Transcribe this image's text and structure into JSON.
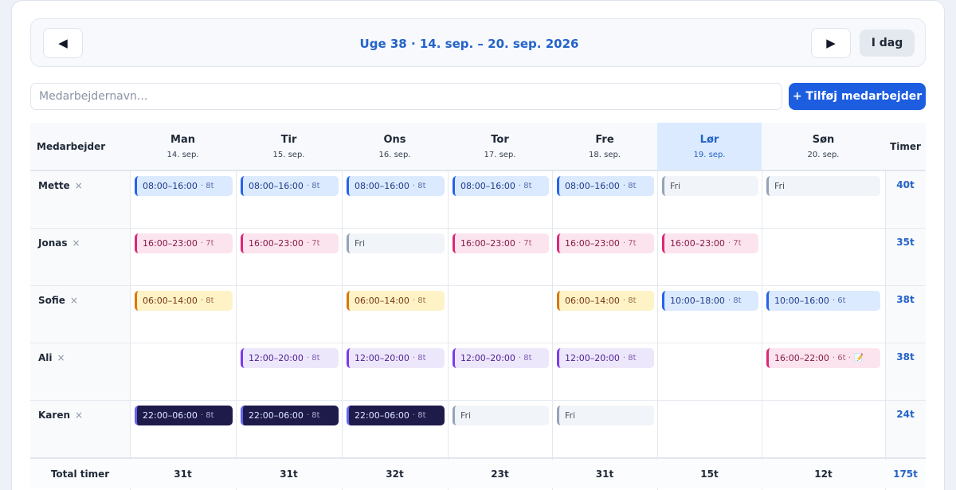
{
  "week_nav": {
    "prev_icon": "triangle-left-icon",
    "prev_glyph": "◀",
    "next_icon": "triangle-right-icon",
    "next_glyph": "▶",
    "title": "Uge 38 · 14. sep. – 20. sep. 2026",
    "today_label": "I dag"
  },
  "add_employee": {
    "placeholder": "Medarbejdernavn...",
    "value": "",
    "button_label": "+ Tilføj medarbejder"
  },
  "table": {
    "employee_header": "Medarbejder",
    "hours_header": "Timer",
    "days": [
      {
        "name": "Man",
        "date": "14. sep.",
        "active": false
      },
      {
        "name": "Tir",
        "date": "15. sep.",
        "active": false
      },
      {
        "name": "Ons",
        "date": "16. sep.",
        "active": false
      },
      {
        "name": "Tor",
        "date": "17. sep.",
        "active": false
      },
      {
        "name": "Fre",
        "date": "18. sep.",
        "active": false
      },
      {
        "name": "Lør",
        "date": "19. sep.",
        "active": true
      },
      {
        "name": "Søn",
        "date": "20. sep.",
        "active": false
      }
    ],
    "remove_glyph": "×",
    "note_glyph": "📝",
    "employees": [
      {
        "name": "Mette",
        "total": "40t",
        "shifts": [
          {
            "time": "08:00–16:00",
            "hours": "· 8t",
            "color": "blue"
          },
          {
            "time": "08:00–16:00",
            "hours": "· 8t",
            "color": "blue"
          },
          {
            "time": "08:00–16:00",
            "hours": "· 8t",
            "color": "blue"
          },
          {
            "time": "08:00–16:00",
            "hours": "· 8t",
            "color": "blue"
          },
          {
            "time": "08:00–16:00",
            "hours": "· 8t",
            "color": "blue"
          },
          {
            "time": "Fri",
            "hours": "",
            "color": "off"
          },
          {
            "time": "Fri",
            "hours": "",
            "color": "off"
          }
        ]
      },
      {
        "name": "Jonas",
        "total": "35t",
        "shifts": [
          {
            "time": "16:00–23:00",
            "hours": "· 7t",
            "color": "pink"
          },
          {
            "time": "16:00–23:00",
            "hours": "· 7t",
            "color": "pink"
          },
          {
            "time": "Fri",
            "hours": "",
            "color": "off"
          },
          {
            "time": "16:00–23:00",
            "hours": "· 7t",
            "color": "pink"
          },
          {
            "time": "16:00–23:00",
            "hours": "· 7t",
            "color": "pink"
          },
          {
            "time": "16:00–23:00",
            "hours": "· 7t",
            "color": "pink"
          },
          null
        ]
      },
      {
        "name": "Sofie",
        "total": "38t",
        "shifts": [
          {
            "time": "06:00–14:00",
            "hours": "· 8t",
            "color": "yellow"
          },
          null,
          {
            "time": "06:00–14:00",
            "hours": "· 8t",
            "color": "yellow"
          },
          null,
          {
            "time": "06:00–14:00",
            "hours": "· 8t",
            "color": "yellow"
          },
          {
            "time": "10:00–18:00",
            "hours": "· 8t",
            "color": "blue"
          },
          {
            "time": "10:00–16:00",
            "hours": "· 6t",
            "color": "blue"
          }
        ]
      },
      {
        "name": "Ali",
        "total": "38t",
        "shifts": [
          null,
          {
            "time": "12:00–20:00",
            "hours": "· 8t",
            "color": "purple"
          },
          {
            "time": "12:00–20:00",
            "hours": "· 8t",
            "color": "purple"
          },
          {
            "time": "12:00–20:00",
            "hours": "· 8t",
            "color": "purple"
          },
          {
            "time": "12:00–20:00",
            "hours": "· 8t",
            "color": "purple"
          },
          null,
          {
            "time": "16:00–22:00",
            "hours": "· 6t ·",
            "color": "pink",
            "note": true
          }
        ]
      },
      {
        "name": "Karen",
        "total": "24t",
        "shifts": [
          {
            "time": "22:00–06:00",
            "hours": "· 8t",
            "color": "navy"
          },
          {
            "time": "22:00–06:00",
            "hours": "· 8t",
            "color": "navy"
          },
          {
            "time": "22:00–06:00",
            "hours": "· 8t",
            "color": "navy"
          },
          {
            "time": "Fri",
            "hours": "",
            "color": "off"
          },
          {
            "time": "Fri",
            "hours": "",
            "color": "off"
          },
          null,
          null
        ]
      }
    ],
    "totals_label": "Total timer",
    "day_totals": [
      "31t",
      "31t",
      "32t",
      "23t",
      "31t",
      "15t",
      "12t"
    ],
    "grand_total": "175t"
  }
}
